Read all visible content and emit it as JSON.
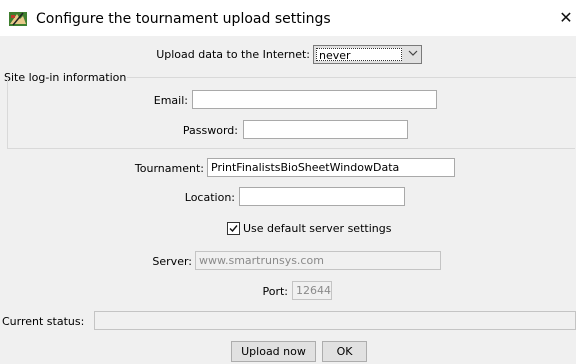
{
  "window": {
    "title": "Configure the tournament upload settings",
    "close_glyph": "✕"
  },
  "upload": {
    "label": "Upload data to the Internet:",
    "selected": "never"
  },
  "login": {
    "group_title": "Site log-in information",
    "email_label": "Email:",
    "email_value": "",
    "password_label": "Password:",
    "password_value": ""
  },
  "tournament": {
    "label": "Tournament:",
    "value": "PrintFinalistsBioSheetWindowData"
  },
  "location": {
    "label": "Location:",
    "value": ""
  },
  "default_server": {
    "checked": true,
    "check_glyph": "✓",
    "label": "Use default server settings"
  },
  "server": {
    "label": "Server:",
    "value": "www.smartrunsys.com"
  },
  "port": {
    "label": "Port:",
    "value": "12644"
  },
  "status": {
    "label": "Current status:",
    "value": ""
  },
  "buttons": {
    "upload_now": "Upload now",
    "ok": "OK"
  },
  "icons": {
    "app": "tournament-app-icon",
    "dropdown": "chevron-down-icon"
  }
}
